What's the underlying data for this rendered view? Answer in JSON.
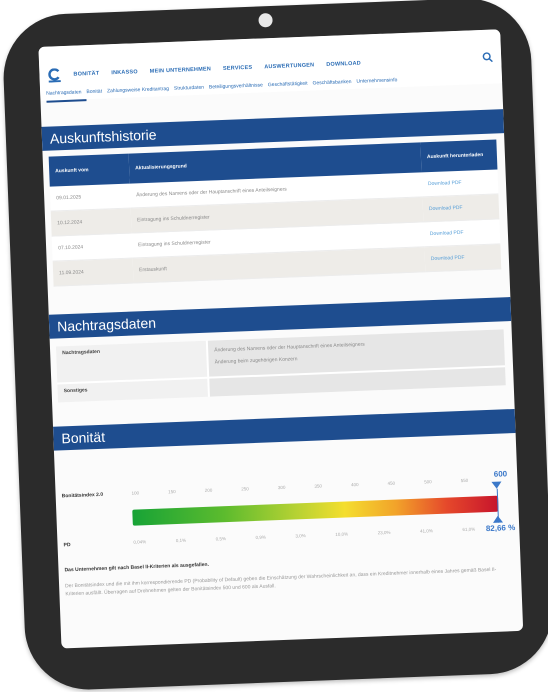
{
  "nav": {
    "items": [
      "BONITÄT",
      "INKASSO",
      "MEIN UNTERNEHMEN",
      "SERVICES",
      "AUSWERTUNGEN",
      "DOWNLOAD"
    ],
    "sub_items": [
      "Nachtragsdaten",
      "Bonität",
      "Zahlungsweise Kreditantrag",
      "Strukturdaten",
      "Beteiligungsverhältnisse",
      "Geschäftstätigkeit",
      "Geschäftsbanken",
      "Unternehmensinfo"
    ]
  },
  "history": {
    "title": "Auskunftshistorie",
    "columns": [
      "Auskunft vom",
      "Aktualisierungsgrund",
      "Auskunft herunterladen"
    ],
    "rows": [
      {
        "date": "09.01.2025",
        "reason": "Änderung des Namens oder der Hauptanschrift eines Anteilseigners",
        "link": "Download PDF"
      },
      {
        "date": "10.12.2024",
        "reason": "Eintragung ins Schuldnerregister",
        "link": "Download PDF"
      },
      {
        "date": "07.10.2024",
        "reason": "Eintragung ins Schuldnerregister",
        "link": "Download PDF"
      },
      {
        "date": "11.09.2024",
        "reason": "Erstauskunft",
        "link": "Download PDF"
      }
    ]
  },
  "nachtrag": {
    "title": "Nachtragsdaten",
    "label": "Nachtragsdaten",
    "values": [
      "Änderung des Namens oder der Hauptanschrift eines Anteilseigners",
      "Änderung beim zugehörigen Konzern"
    ],
    "other_label": "Sonstiges"
  },
  "bonitaet": {
    "title": "Bonität",
    "index_label": "Bonitätsindex 2.0",
    "index_ticks": [
      "100",
      "150",
      "200",
      "250",
      "300",
      "350",
      "400",
      "450",
      "500",
      "550"
    ],
    "index_value": "600",
    "pd_label": "PD",
    "pd_ticks": [
      "0,04%",
      "0,1%",
      "0,5%",
      "0,9%",
      "3,0%",
      "10,0%",
      "23,0%",
      "41,0%",
      "61,0%"
    ],
    "pd_value": "82,66 %",
    "index_fraction": 1.0,
    "basel_text": "Das Unternehmen gilt nach Basel II-Kriterien als ausgefallen.",
    "description": "Der Bonitätsindex und die mit ihm korrespondierende PD (Probability of Default) geben die Einschätzung der Wahrscheinlichkeit an, dass ein Kreditnehmer innerhalb eines Jahres gemäß Basel II-Kriterien ausfällt. Überragen auf Drohnehmen gelten der Bonitätsindex 500 und 600 als Ausfall."
  }
}
